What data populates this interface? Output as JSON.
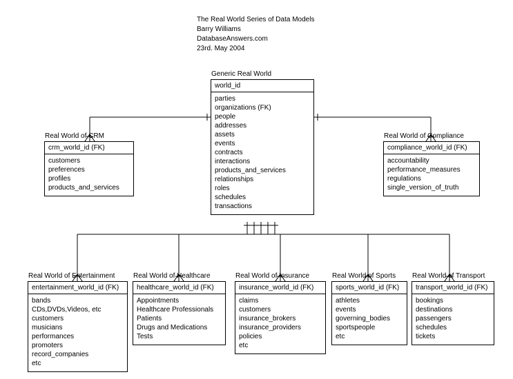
{
  "header": {
    "line1": "The Real World Series of Data Models",
    "line2": "Barry Williams",
    "line3": "DatabaseAnswers.com",
    "line4": "23rd. May 2004"
  },
  "entities": {
    "generic": {
      "title": "Generic Real World",
      "pk": "world_id",
      "attrs": [
        "parties",
        "organizations (FK)",
        "people",
        "addresses",
        "assets",
        "events",
        "contracts",
        "interactions",
        "products_and_services",
        "relationships",
        "roles",
        "schedules",
        "transactions"
      ]
    },
    "crm": {
      "title": "Real World of CRM",
      "pk": "crm_world_id (FK)",
      "attrs": [
        "customers",
        "preferences",
        "profiles",
        "products_and_services"
      ]
    },
    "compliance": {
      "title": "Real World of Compliance",
      "pk": "compliance_world_id (FK)",
      "attrs": [
        "accountability",
        "performance_measures",
        "regulations",
        "single_version_of_truth"
      ]
    },
    "entertainment": {
      "title": "Real World of Entertainment",
      "pk": "entertainment_world_id (FK)",
      "attrs": [
        "bands",
        "CDs,DVDs,Videos, etc",
        "customers",
        "musicians",
        "performances",
        "promoters",
        "record_companies",
        "etc"
      ]
    },
    "healthcare": {
      "title": "Real World of Healthcare",
      "pk": "healthcare_world_id (FK)",
      "attrs": [
        "Appointments",
        "Healthcare Professionals",
        "Patients",
        "Drugs and Medications",
        "Tests"
      ]
    },
    "insurance": {
      "title": "Real World of Insurance",
      "pk": "insurance_world_id (FK)",
      "attrs": [
        "claims",
        "customers",
        "insurance_brokers",
        "insurance_providers",
        "policies",
        "etc"
      ]
    },
    "sports": {
      "title": "Real World of Sports",
      "pk": "sports_world_id (FK)",
      "attrs": [
        "athletes",
        "events",
        "governing_bodies",
        "sportspeople",
        "etc"
      ]
    },
    "transport": {
      "title": "Real World of Transport",
      "pk": "transport_world_id (FK)",
      "attrs": [
        "bookings",
        "destinations",
        "passengers",
        "schedules",
        "tickets"
      ]
    }
  }
}
